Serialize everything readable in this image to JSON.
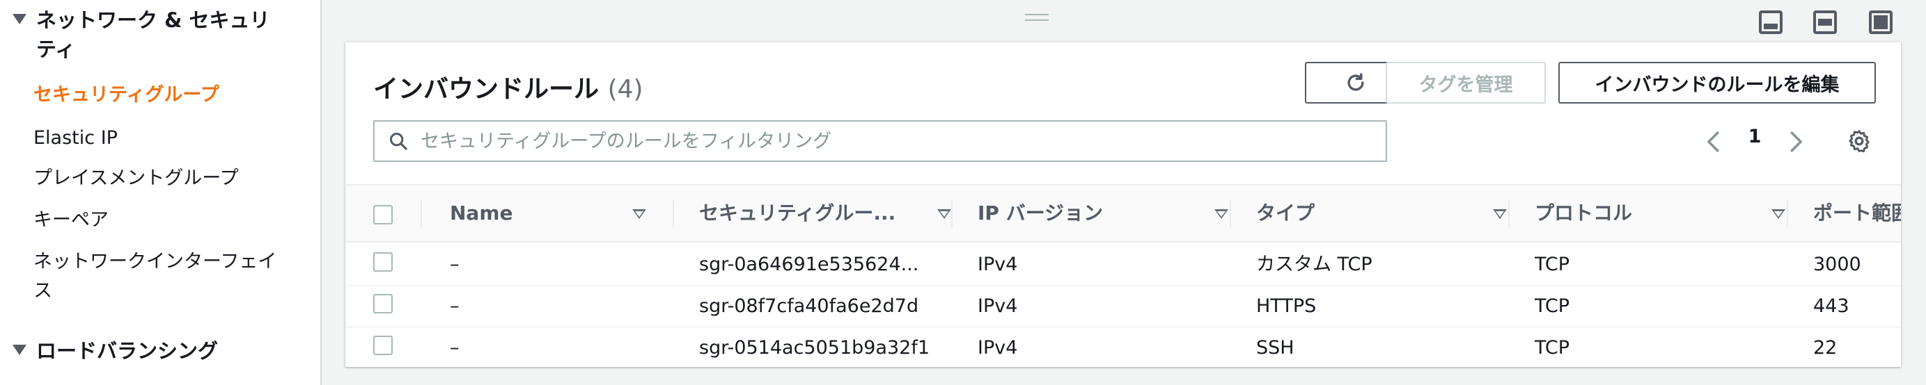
{
  "sidebar": {
    "section_network": "ネットワーク & セキュリティ",
    "items": [
      {
        "label": "セキュリティグループ",
        "active": true
      },
      {
        "label": "Elastic IP"
      },
      {
        "label": "プレイスメントグループ"
      },
      {
        "label": "キーペア"
      },
      {
        "label": "ネットワークインターフェイス"
      }
    ],
    "section_lb": "ロードバランシング"
  },
  "panel": {
    "title": "インバウンドルール",
    "count": "(4)",
    "refresh_icon": "refresh-icon",
    "manage_tags_label": "タグを管理",
    "edit_rules_label": "インバウンドのルールを編集",
    "search_placeholder": "セキュリティグループのルールをフィルタリング",
    "page": "1"
  },
  "table": {
    "columns": [
      "Name",
      "セキュリティグルー...",
      "IP バージョン",
      "タイプ",
      "プロトコル",
      "ポート範囲"
    ],
    "rows": [
      {
        "name": "–",
        "sg": "sgr-0a64691e535624...",
        "ip": "IPv4",
        "type": "カスタム TCP",
        "protocol": "TCP",
        "port": "3000"
      },
      {
        "name": "–",
        "sg": "sgr-08f7cfa40fa6e2d7d",
        "ip": "IPv4",
        "type": "HTTPS",
        "protocol": "TCP",
        "port": "443"
      },
      {
        "name": "–",
        "sg": "sgr-0514ac5051b9a32f1",
        "ip": "IPv4",
        "type": "SSH",
        "protocol": "TCP",
        "port": "22"
      }
    ]
  },
  "colors": {
    "accent_orange": "#ec7211",
    "text": "#16191f",
    "muted": "#687078",
    "border": "#eaeded"
  }
}
